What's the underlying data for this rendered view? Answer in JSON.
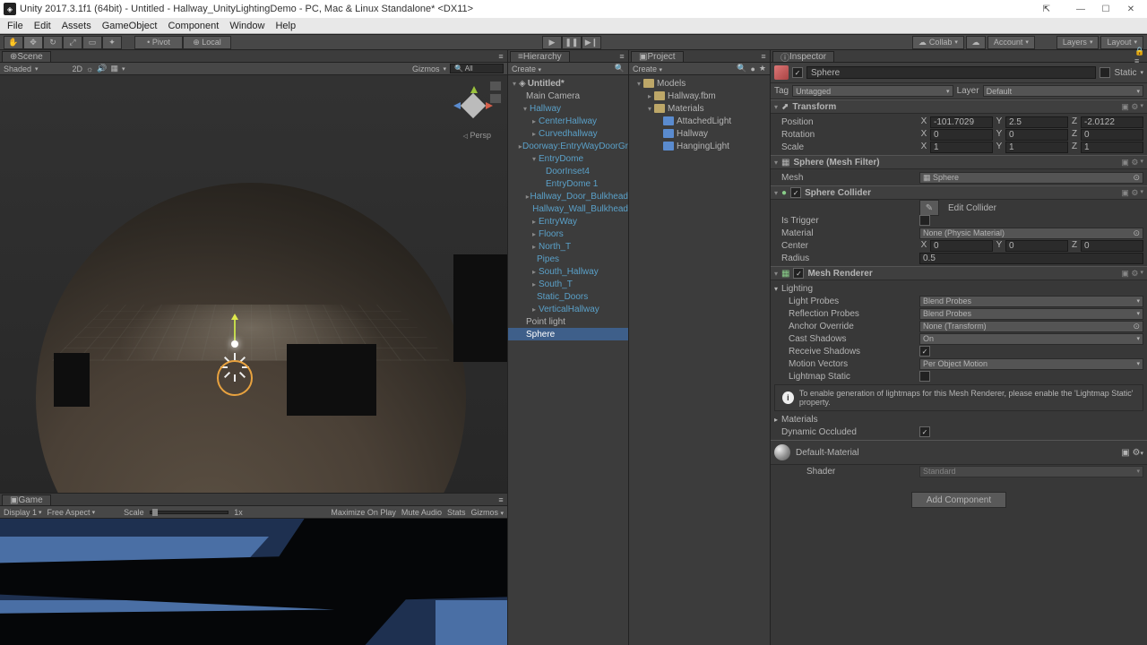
{
  "window": {
    "title": "Unity 2017.3.1f1 (64bit) - Untitled - Hallway_UnityLightingDemo - PC, Mac & Linux Standalone* <DX11>"
  },
  "menu": {
    "items": [
      "File",
      "Edit",
      "Assets",
      "GameObject",
      "Component",
      "Window",
      "Help"
    ]
  },
  "toolbar": {
    "pivot": "Pivot",
    "local": "Local",
    "collab": "Collab",
    "account": "Account",
    "layers": "Layers",
    "layout": "Layout"
  },
  "scene": {
    "tab": "Scene",
    "shaded": "Shaded",
    "twod": "2D",
    "gizmos": "Gizmos",
    "all": "All",
    "persp": "Persp"
  },
  "game": {
    "tab": "Game",
    "display": "Display 1",
    "aspect": "Free Aspect",
    "scale": "Scale",
    "scaleVal": "1x",
    "maxOnPlay": "Maximize On Play",
    "muteAudio": "Mute Audio",
    "stats": "Stats",
    "gizmos": "Gizmos"
  },
  "hierarchy": {
    "tab": "Hierarchy",
    "create": "Create",
    "root": "Untitled*",
    "items": [
      "Main Camera",
      "Hallway",
      "CenterHallway",
      "Curvedhallway",
      "Doorway:EntryWayDoorGr",
      "EntryDome",
      "DoorInset4",
      "EntryDome 1",
      "Hallway_Door_Bulkhead",
      "Hallway_Wall_Bulkhead",
      "EntryWay",
      "Floors",
      "North_T",
      "Pipes",
      "South_Hallway",
      "South_T",
      "Static_Doors",
      "VerticalHallway",
      "Point light",
      "Sphere"
    ]
  },
  "project": {
    "tab": "Project",
    "create": "Create",
    "folders": [
      "Models",
      "Hallway.fbm",
      "Materials",
      "AttachedLight",
      "Hallway",
      "HangingLight"
    ]
  },
  "inspector": {
    "tab": "Inspector",
    "objName": "Sphere",
    "static": "Static",
    "tagLabel": "Tag",
    "tagValue": "Untagged",
    "layerLabel": "Layer",
    "layerValue": "Default",
    "transform": {
      "title": "Transform",
      "pos": {
        "label": "Position",
        "x": "-101.7029",
        "y": "2.5",
        "z": "-2.0122"
      },
      "rot": {
        "label": "Rotation",
        "x": "0",
        "y": "0",
        "z": "0"
      },
      "scl": {
        "label": "Scale",
        "x": "1",
        "y": "1",
        "z": "1"
      }
    },
    "meshFilter": {
      "title": "Sphere (Mesh Filter)",
      "meshLabel": "Mesh",
      "meshValue": "Sphere"
    },
    "sphereCollider": {
      "title": "Sphere Collider",
      "editCollider": "Edit Collider",
      "isTrigger": "Is Trigger",
      "material": "Material",
      "materialValue": "None (Physic Material)",
      "center": "Center",
      "cx": "0",
      "cy": "0",
      "cz": "0",
      "radius": "Radius",
      "radiusValue": "0.5"
    },
    "meshRenderer": {
      "title": "Mesh Renderer",
      "lighting": "Lighting",
      "lightProbes": "Light Probes",
      "lightProbesValue": "Blend Probes",
      "reflectionProbes": "Reflection Probes",
      "reflectionProbesValue": "Blend Probes",
      "anchorOverride": "Anchor Override",
      "anchorOverrideValue": "None (Transform)",
      "castShadows": "Cast Shadows",
      "castShadowsValue": "On",
      "receiveShadows": "Receive Shadows",
      "motionVectors": "Motion Vectors",
      "motionVectorsValue": "Per Object Motion",
      "lightmapStatic": "Lightmap Static",
      "info": "To enable generation of lightmaps for this Mesh Renderer, please enable the 'Lightmap Static' property.",
      "materials": "Materials",
      "dynamicOccluded": "Dynamic Occluded"
    },
    "material": {
      "name": "Default-Material",
      "shaderLabel": "Shader",
      "shaderValue": "Standard"
    },
    "addComponent": "Add Component"
  }
}
